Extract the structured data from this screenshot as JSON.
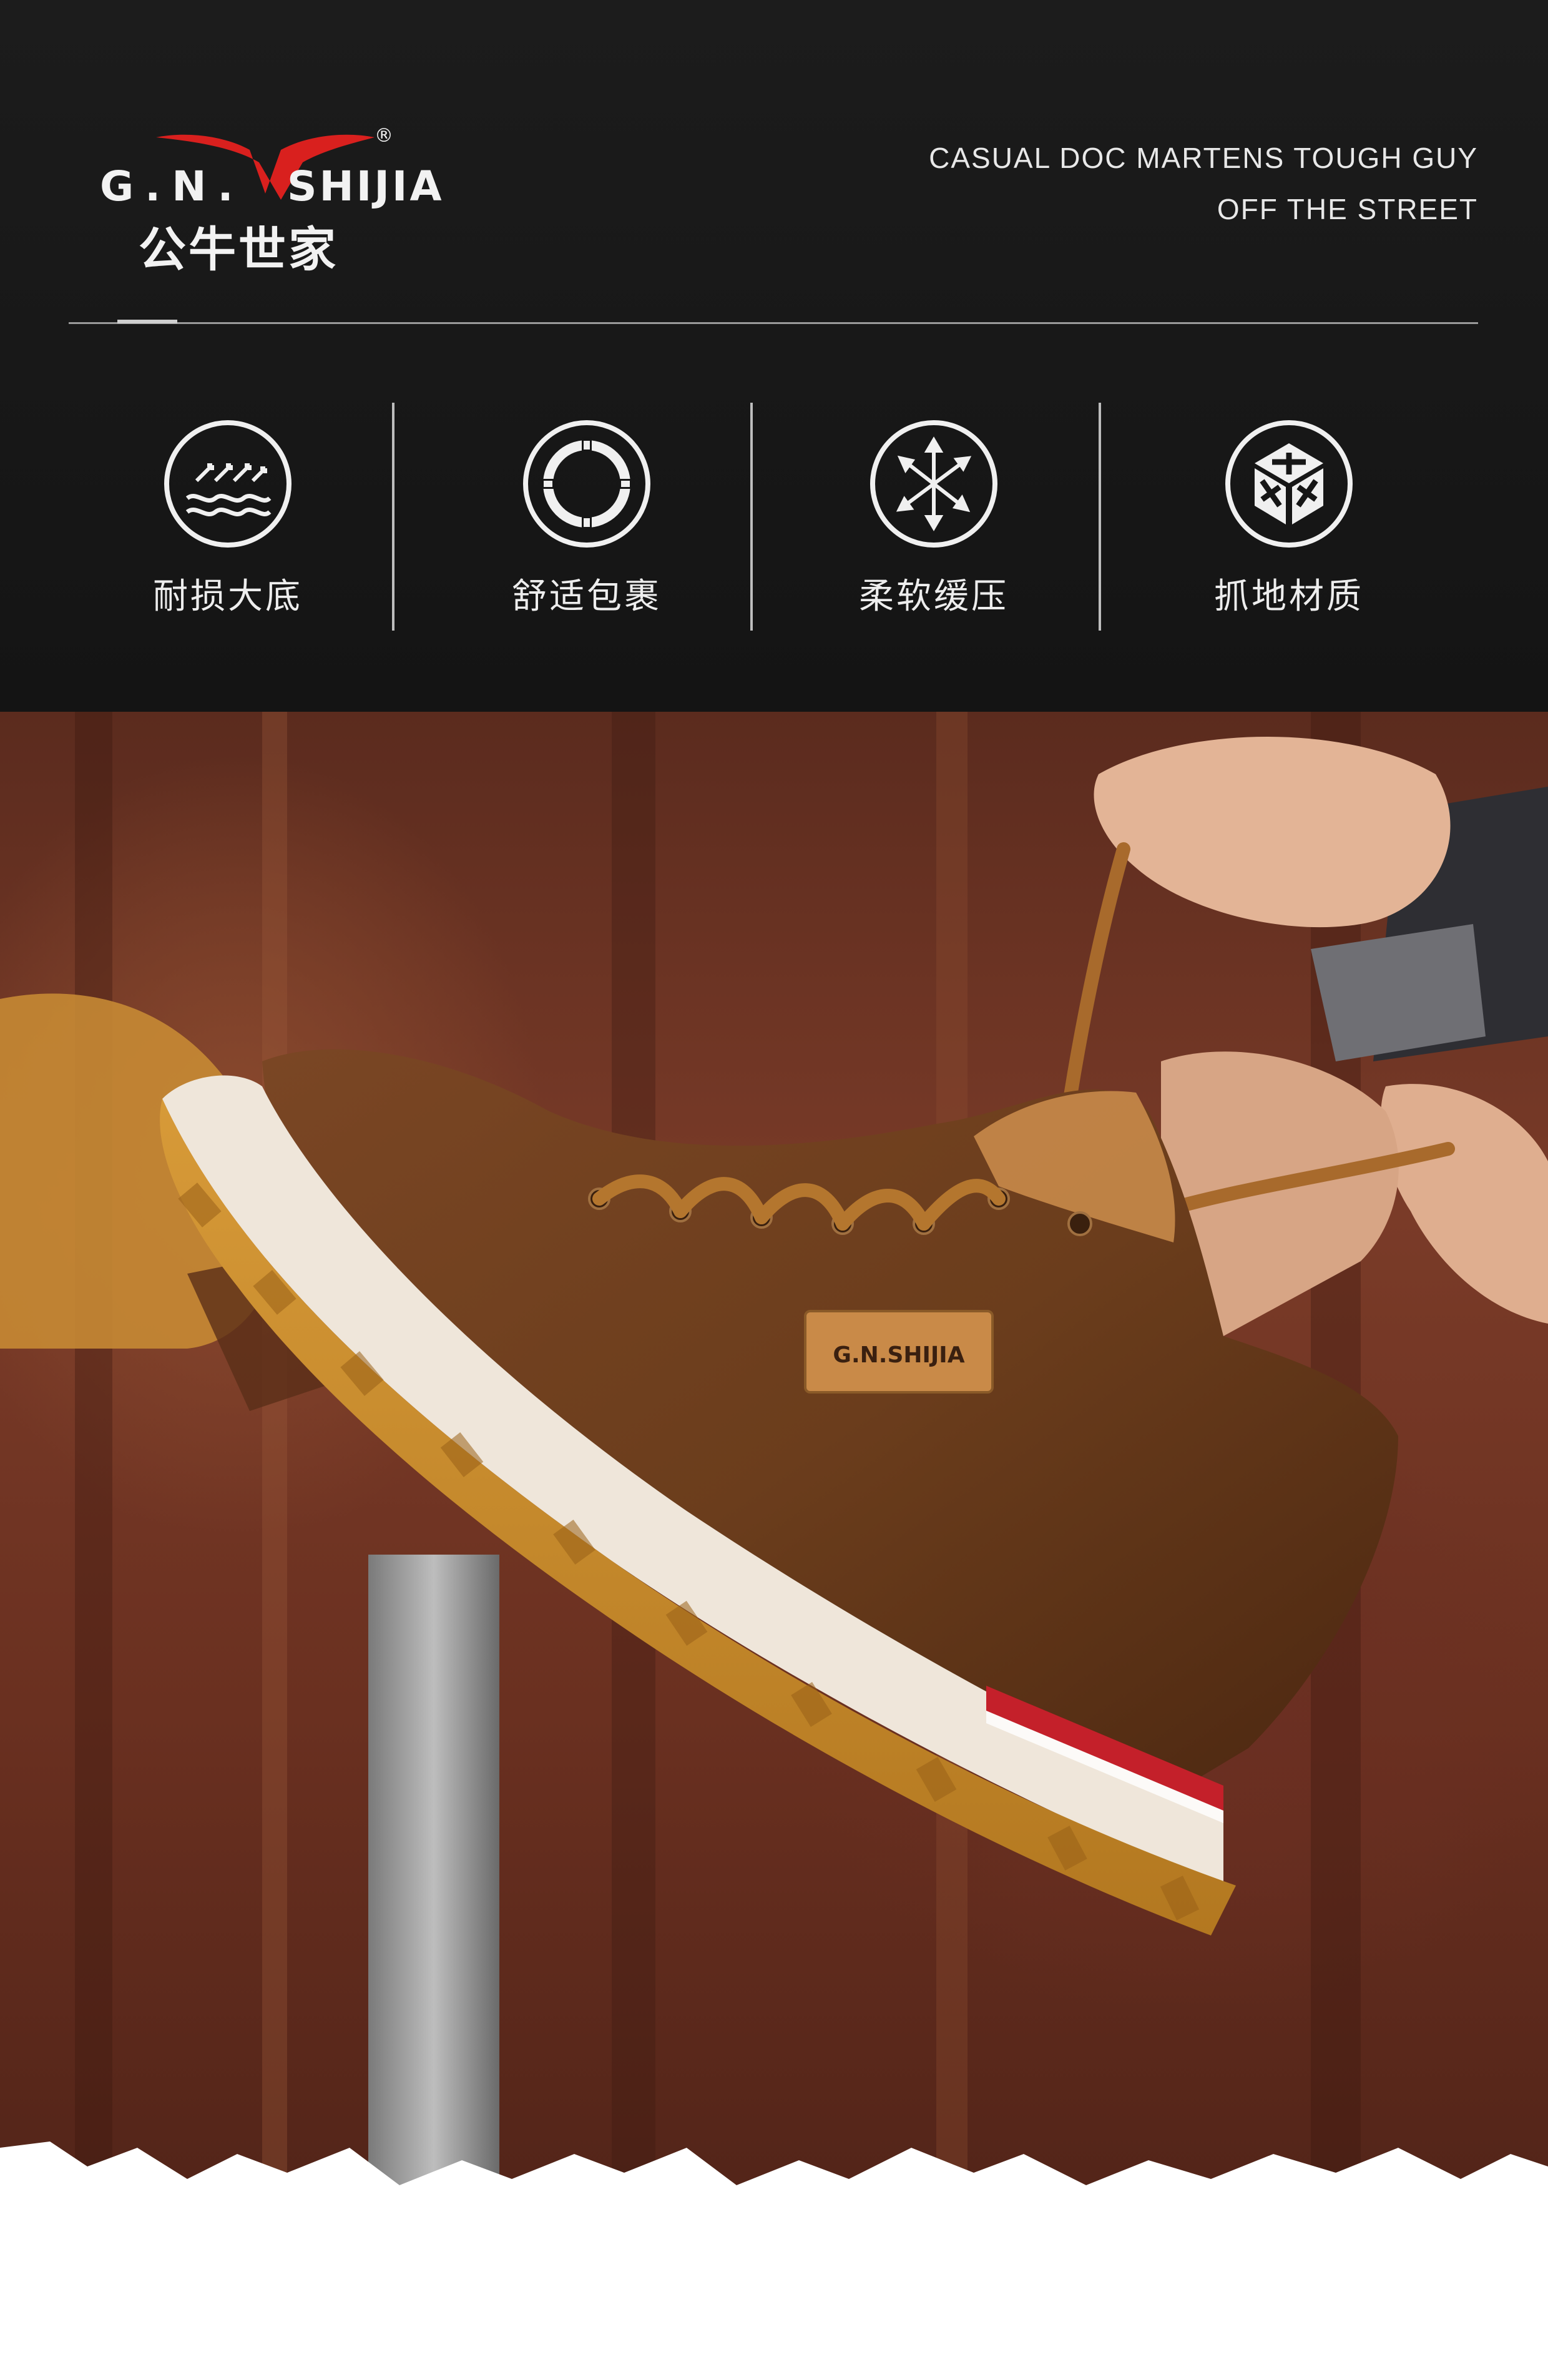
{
  "brand": {
    "latin_gn": "G.N.",
    "latin_name": "SHIJIA",
    "registered_mark": "®",
    "chinese_name": "公牛世家",
    "logo_color": "#d9201e"
  },
  "tagline": {
    "line1": "CASUAL DOC MARTENS TOUGH GUY",
    "line2": "OFF THE STREET"
  },
  "features": [
    {
      "icon": "wave-sole-icon",
      "label": "耐损大底"
    },
    {
      "icon": "comfort-ring-icon",
      "label": "舒适包裹"
    },
    {
      "icon": "cushion-arrows-icon",
      "label": "柔软缓压"
    },
    {
      "icon": "grip-cube-icon",
      "label": "抓地材质"
    }
  ],
  "product": {
    "tongue_label": "G.N.SHIJIA",
    "upper_color": "#6b3d1c",
    "sole_color": "#c98d2e",
    "midsole_color": "#efe6da",
    "heel_stripe_color": "#c4202a"
  },
  "colors": {
    "header_bg": "#161616",
    "text": "#ededed"
  }
}
